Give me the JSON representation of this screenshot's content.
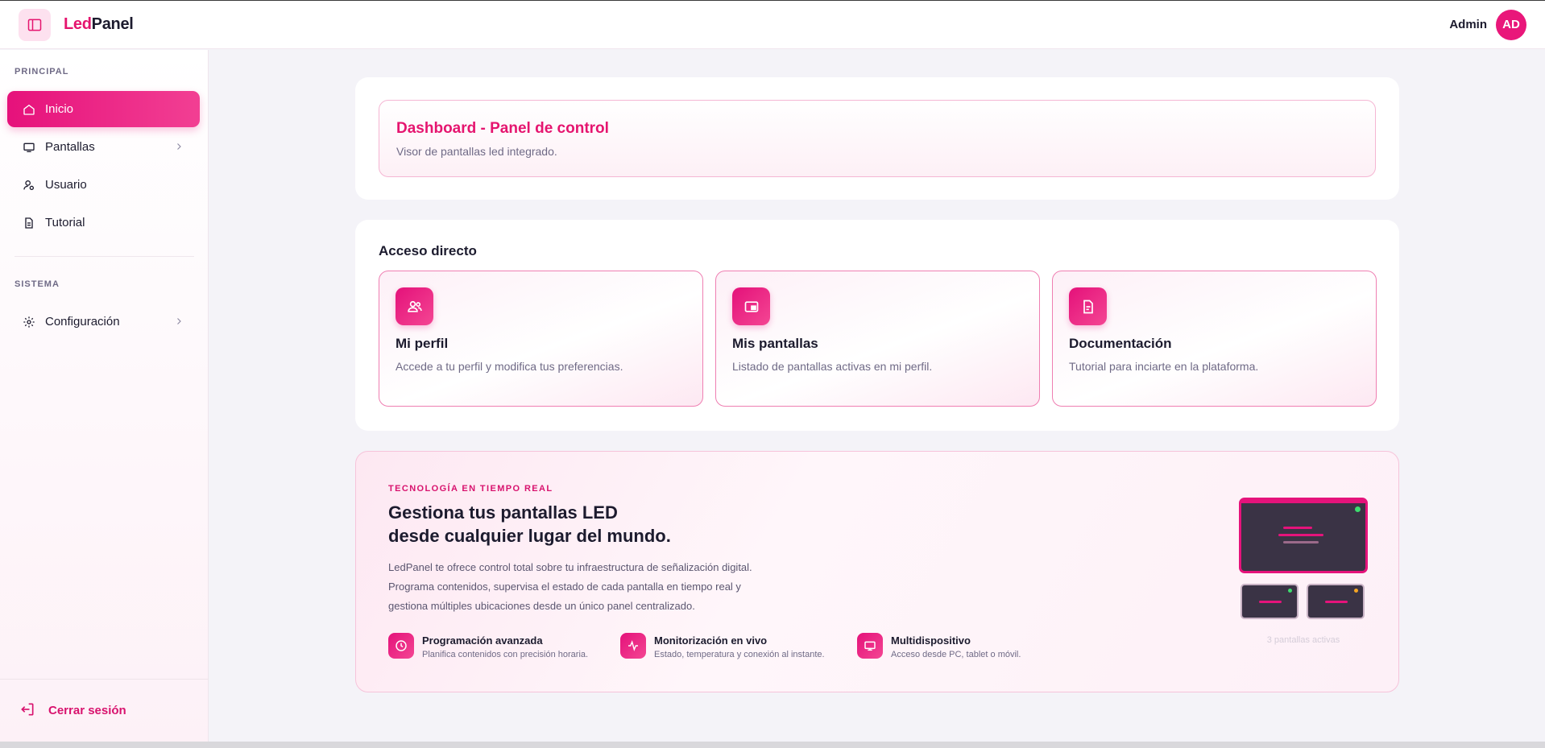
{
  "header": {
    "logo_part1": "Led",
    "logo_part2": "Panel",
    "user_name": "Admin",
    "avatar_initials": "AD"
  },
  "sidebar": {
    "section_principal": "PRINCIPAL",
    "section_sistema": "SISTEMA",
    "items": [
      {
        "label": "Inicio",
        "icon": "home-icon",
        "active": true
      },
      {
        "label": "Pantallas",
        "icon": "monitor-icon",
        "has_submenu": true
      },
      {
        "label": "Usuario",
        "icon": "user-gear-icon"
      },
      {
        "label": "Tutorial",
        "icon": "document-icon"
      }
    ],
    "system_items": [
      {
        "label": "Configuración",
        "icon": "gear-icon",
        "has_submenu": true
      }
    ],
    "logout_label": "Cerrar sesión"
  },
  "dashboard": {
    "title": "Dashboard - Panel de control",
    "subtitle": "Visor de pantallas led integrado."
  },
  "access": {
    "title": "Acceso directo",
    "tiles": [
      {
        "title": "Mi perfil",
        "desc": "Accede a tu perfil y modifica tus preferencias.",
        "icon": "users-icon"
      },
      {
        "title": "Mis pantallas",
        "desc": "Listado de pantallas activas en mi perfil.",
        "icon": "picture-in-picture-icon"
      },
      {
        "title": "Documentación",
        "desc": "Tutorial para inciarte en la plataforma.",
        "icon": "file-text-icon"
      }
    ]
  },
  "promo": {
    "eyebrow": "TECNOLOGÍA EN TIEMPO REAL",
    "headline_line1": "Gestiona tus pantallas LED",
    "headline_line2": "desde cualquier lugar del mundo.",
    "desc_line1": "LedPanel te ofrece control total sobre tu infraestructura de señalización digital.",
    "desc_line2": "Programa contenidos, supervisa el estado de cada pantalla en tiempo real y",
    "desc_line3": "gestiona múltiples ubicaciones desde un único panel centralizado.",
    "features": [
      {
        "title": "Programación avanzada",
        "desc": "Planifica contenidos con precisión horaria.",
        "icon": "clock-icon"
      },
      {
        "title": "Monitorización en vivo",
        "desc": "Estado, temperatura y conexión al instante.",
        "icon": "activity-icon"
      },
      {
        "title": "Multidispositivo",
        "desc": "Acceso desde PC, tablet o móvil.",
        "icon": "monitor-icon"
      }
    ],
    "screens_caption": "3 pantallas activas",
    "status_colors": {
      "online": "#3ddc6e",
      "warning": "#f5a524"
    }
  },
  "colors": {
    "accent": "#e5156f",
    "text": "#1c1b2e",
    "muted": "#6f6a86"
  }
}
